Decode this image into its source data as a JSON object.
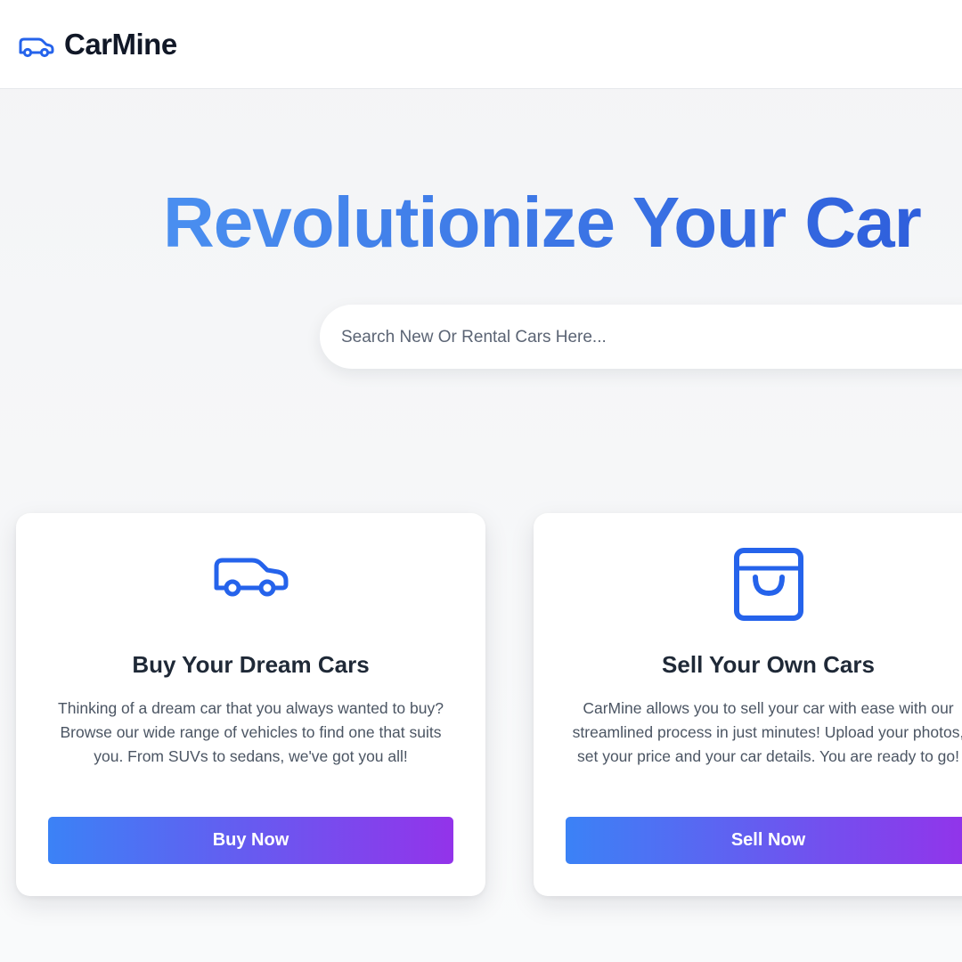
{
  "header": {
    "brand": "CarMine",
    "logo_icon": "car-icon"
  },
  "hero": {
    "title": "Revolutionize Your Car",
    "search_placeholder": "Search New Or Rental Cars Here..."
  },
  "cards": [
    {
      "icon": "car-icon",
      "title": "Buy Your Dream Cars",
      "text": "Thinking of a dream car that you always wanted to buy? Browse our wide range of vehicles to find one that suits you. From SUVs to sedans, we've got you all!",
      "button_label": "Buy Now"
    },
    {
      "icon": "shopping-bag-icon",
      "title": "Sell Your Own Cars",
      "text": "CarMine allows you to sell your car with ease with our streamlined process in just minutes! Upload your photos, set your price and your car details. You are ready to go!",
      "button_label": "Sell Now"
    }
  ],
  "colors": {
    "accent": "#2563eb",
    "gradient_start": "#3b82f6",
    "gradient_end": "#9333ea",
    "heading": "#1f2937"
  }
}
